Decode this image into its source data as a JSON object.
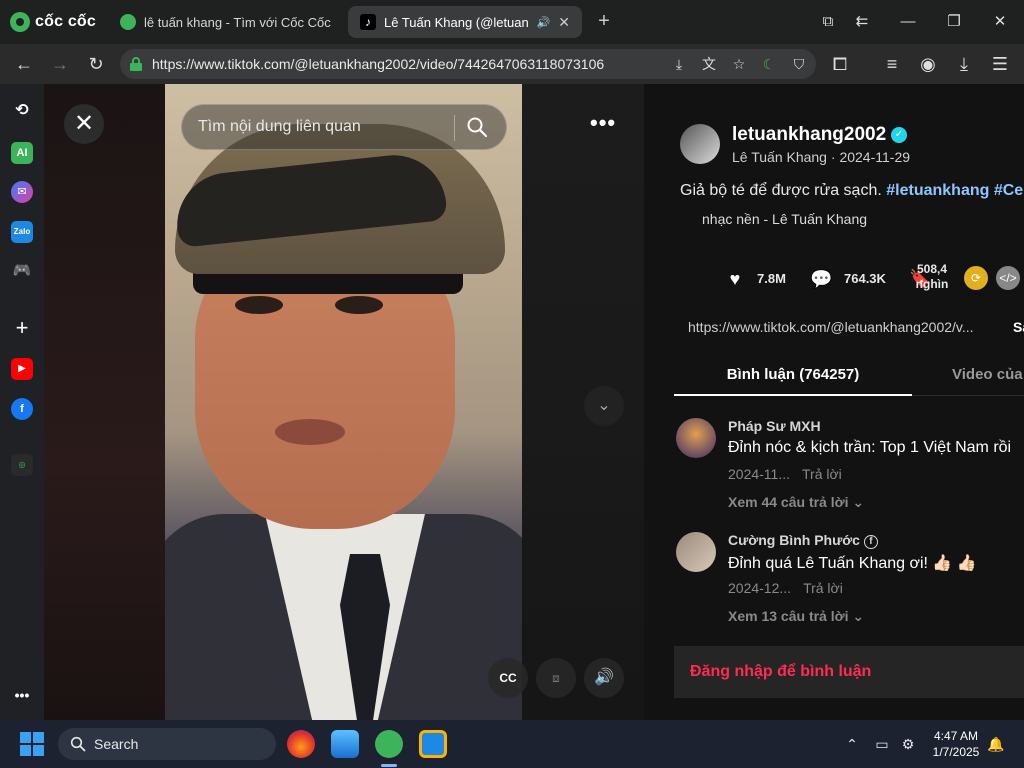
{
  "browser": {
    "brand": "cốc cốc",
    "tabs": [
      {
        "title": "lê tuấn khang - Tìm với Cốc Cốc",
        "active": false
      },
      {
        "title": "Lê Tuấn Khang (@letuanl",
        "active": true
      }
    ],
    "new_tab": "+",
    "url": "https://www.tiktok.com/@letuankhang2002/video/7442647063118073106",
    "window_controls": {
      "minimize": "—",
      "maximize": "❐",
      "close": "✕"
    }
  },
  "player": {
    "search_placeholder": "Tìm nội dung liên quan",
    "close_symbol": "✕",
    "more_symbol": "•••",
    "captions_label": "CC"
  },
  "video_info": {
    "username": "letuankhang2002",
    "display_name": "Lê Tuấn Khang",
    "date": "2024-11-29",
    "separator": " · ",
    "caption_text": "Giả bộ té để được rửa sạch.",
    "hashtags": [
      "#letuankhang",
      "#Ce"
    ],
    "music": "nhạc nền - Lê Tuấn Khang",
    "likes": "7.8M",
    "comments": "764.3K",
    "shares_line1": "508,4",
    "shares_line2": "nghìn",
    "link": "https://www.tiktok.com/@letuankhang2002/v...",
    "copy_link": "Sa"
  },
  "tabs": {
    "comments": "Bình luận (764257)",
    "videos": "Video của n"
  },
  "comments": [
    {
      "user": "Pháp Sư MXH",
      "text": "Đỉnh nóc & kịch trần: Top 1 Việt Nam rồi",
      "date": "2024-11...",
      "reply": "Trả lời",
      "view_replies": "Xem 44 câu trả lời"
    },
    {
      "user": "Cường Bình Phước",
      "text": "Đỉnh quá Lê Tuấn Khang ơi! 👍🏻 👍🏻",
      "date": "2024-12...",
      "reply": "Trả lời",
      "view_replies": "Xem 13 câu trả lời"
    }
  ],
  "login_prompt": "Đăng nhập để bình luận",
  "taskbar": {
    "search_label": "Search",
    "time": "4:47 AM",
    "date": "1/7/2025"
  },
  "colors": {
    "accent_green": "#3db35a",
    "tiktok_red": "#fe2c55",
    "hashtag_blue": "#8fc6ff",
    "verified": "#20d5ec"
  }
}
